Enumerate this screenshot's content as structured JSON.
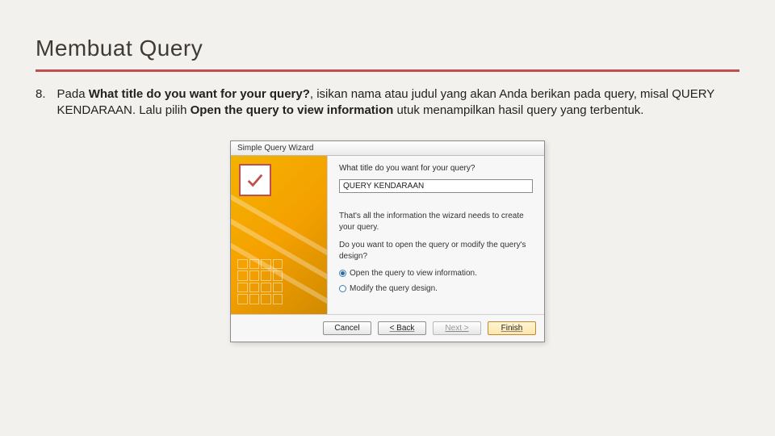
{
  "title": "Membuat Query",
  "list": {
    "num": "8.",
    "before": "Pada ",
    "bold1": "What title do you want for your query?",
    "mid": ", isikan nama atau judul yang akan Anda berikan pada query, misal QUERY KENDARAAN. Lalu pilih ",
    "bold2": "Open the query to view information",
    "after": " utuk menampilkan hasil query yang terbentuk."
  },
  "wizard": {
    "titlebar": "Simple Query Wizard",
    "question": "What title do you want for your query?",
    "input_value": "QUERY KENDARAAN",
    "info1": "That's all the information the wizard needs to create your query.",
    "info2": "Do you want to open the query or modify the query's design?",
    "opt1": "Open the query to view information.",
    "opt2": "Modify the query design.",
    "btn_cancel": "Cancel",
    "btn_back": "< Back",
    "btn_next": "Next >",
    "btn_finish": "Finish"
  }
}
